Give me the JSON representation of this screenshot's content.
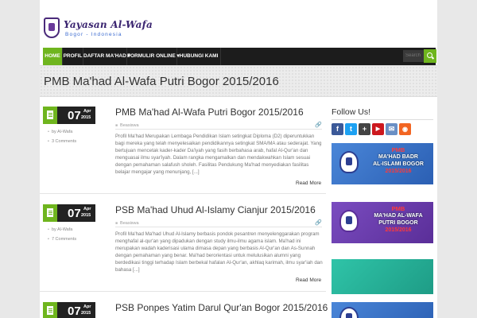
{
  "brand": {
    "title": "Yayasan Al-Wafa",
    "subtitle": "Bogor - Indonesia"
  },
  "nav": {
    "items": [
      {
        "label": "HOME",
        "active": true
      },
      {
        "label": "PROFIL",
        "active": false
      },
      {
        "label": "DAFTAR MA'HAD",
        "active": false
      },
      {
        "label": "FORMULIR ONLINE",
        "active": false
      },
      {
        "label": "HUBUNGI KAMI",
        "active": false
      }
    ],
    "dropdown_glyph": "▾",
    "search_placeholder": "Search"
  },
  "page": {
    "title": "PMB Ma'had Al-Wafa Putri Bogor 2015/2016"
  },
  "posts": [
    {
      "day": "07",
      "month": "Apr",
      "year": "2015",
      "author": "by Al-Wafa",
      "comments": "3 Comments",
      "title": "PMB Ma'had Al-Wafa Putri Bogor 2015/2016",
      "category": "Beasiswa",
      "excerpt": "Profil  Ma'had Merupakan Lembaga Pendidikan Islam setingkat Diploma (D2) diperuntukkan bagi mereka yang telah menyelesaikan pendidikannya setingkat SMA/MA atau sederajat. Yang bertujuan mencetak kader-kader Da'iyah yang fasih berbahasa arab, hafal Al-Qur'an dan menguasai ilmu syar'iyah. Dalam rangka mengamalkan dan mendakwahkan Islam sesuai dengan pemahaman salafush sholeh. Fasilitas Pendukung Ma'had menyediakan fasilitas belajar mengajar yang menunjang, [...]",
      "read_more": "Read More"
    },
    {
      "day": "07",
      "month": "Apr",
      "year": "2015",
      "author": "by Al-Wafa",
      "comments": "7 Comments",
      "title": "PSB Ma'had Uhud Al-Islamy Cianjur 2015/2016",
      "category": "Beasiswa",
      "excerpt": "Profil Ma'had Ma'had Uhud Al-Islamy berbasis pondok pesantren menyelenggarakan program menghafal al-qur'an yang dipadukan dengan study ilmu-ilmu agama islam. Ma'had ini merupakan wadah kaderisasi ulama dimasa depan yang berbasis Al-Qur'an dan As-Sunnah dengan pemahaman yang benar. Ma'had berorientasi untuk melulusikan alumni yang berdedikasi tinggi terhadap Islam berbekal hafalan Al-Qur'an, akhlaq karimah, ilmu syar'iah dan bahasa [...]",
      "read_more": "Read More"
    },
    {
      "day": "07",
      "month": "Apr",
      "year": "2015",
      "title": "PSB Ponpes Yatim Darul Qur'an Bogor 2015/2016"
    }
  ],
  "sidebar": {
    "follow_title": "Follow Us!",
    "social": [
      {
        "name": "facebook-icon",
        "glyph": "f",
        "color": "#3b5998"
      },
      {
        "name": "twitter-icon",
        "glyph": "t",
        "color": "#1da1f2"
      },
      {
        "name": "google-plus-icon",
        "glyph": "+",
        "color": "#444444"
      },
      {
        "name": "youtube-icon",
        "glyph": "▶",
        "color": "#cc181e"
      },
      {
        "name": "email-icon",
        "glyph": "✉",
        "color": "#6a8fc4"
      },
      {
        "name": "rss-icon",
        "glyph": "◉",
        "color": "#f26522"
      }
    ],
    "banners": [
      {
        "pmb": "PMB",
        "lines": [
          "MA'HAD BADR",
          "AL-ISLAMI BOGOR"
        ],
        "year": "2015/2016",
        "bg": "#3a6fc6"
      },
      {
        "pmb": "PMB",
        "lines": [
          "MA'HAD AL-WAFA",
          "PUTRI BOGOR"
        ],
        "year": "2015/2016",
        "bg": "#6a3ea8"
      },
      {
        "pmb": "",
        "lines": [],
        "year": "",
        "bg": "#26b39a"
      },
      {
        "pmb": "",
        "lines": [],
        "year": "",
        "bg": "#3a6fc6"
      }
    ]
  },
  "colors": {
    "accent": "#6fb51e",
    "nav_bg": "#1c1c1c"
  }
}
